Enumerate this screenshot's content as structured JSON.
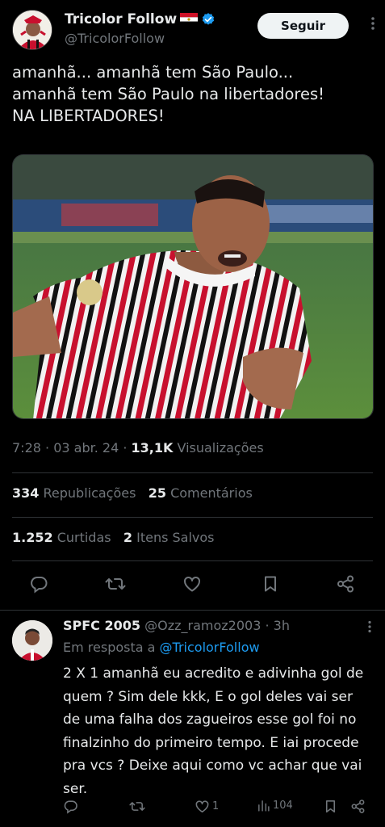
{
  "tweet": {
    "author": {
      "display_name": "Tricolor Follow",
      "flag_emoji": "🇪🇬",
      "verified_icon": "verified-badge-icon",
      "handle": "@TricolorFollow"
    },
    "follow_label": "Seguir",
    "more_icon": "more-horizontal-icon",
    "text": "amanhã... amanhã tem São Paulo...\namanhã tem São Paulo na libertadores!\nNA LIBERTADORES!",
    "meta": {
      "time": "7:28",
      "separator": " · ",
      "date": "03 abr. 24",
      "views_count": "13,1K",
      "views_label": " Visualizações"
    },
    "stats": {
      "reposts_count": "334",
      "reposts_label": " Republicações",
      "comments_count": "25",
      "comments_label": " Comentários",
      "likes_count": "1.252",
      "likes_label": " Curtidas",
      "saves_count": "2",
      "saves_label": " Itens Salvos"
    },
    "actions": [
      "reply-icon",
      "repost-icon",
      "like-icon",
      "bookmark-icon",
      "share-icon"
    ]
  },
  "reply": {
    "display_name": "SPFC 2005",
    "handle": "@Ozz_ramoz2003",
    "time": " · 3h",
    "reply_to_prefix": "Em resposta a ",
    "reply_to_mention": "@TricolorFollow",
    "text": "2 X 1 amanhã eu acredito e adivinha gol de quem ? Sim dele kkk, E o gol deles vai ser de uma falha dos zagueiros esse gol foi no finalzinho do primeiro tempo. E iai procede pra vcs ? Deixe aqui como vc achar que vai ser.",
    "likes": "1",
    "views": "104"
  },
  "colors": {
    "background": "#000000",
    "text": "#e7e9ea",
    "muted": "#71767b",
    "accent": "#1d9bf0",
    "divider": "#2f3336"
  }
}
